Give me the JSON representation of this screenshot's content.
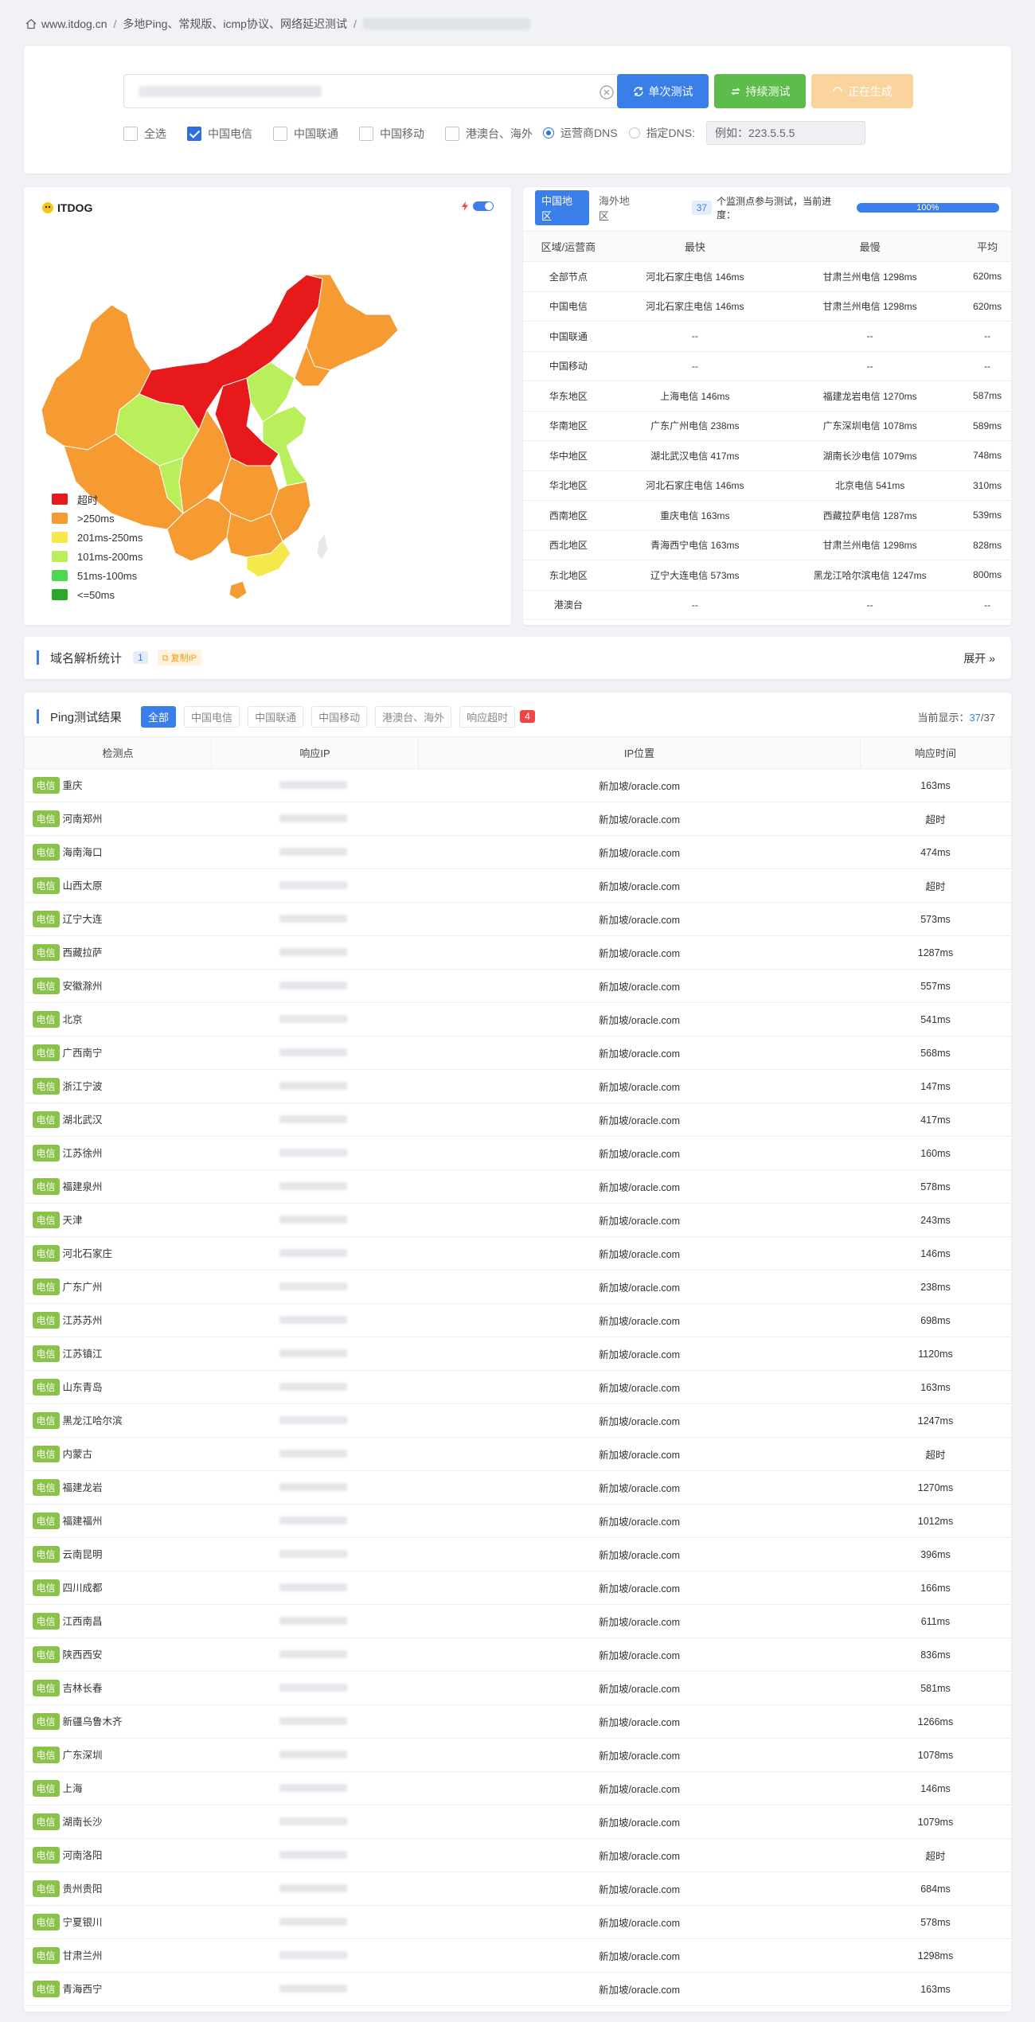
{
  "breadcrumb": {
    "home": "www.itdog.cn",
    "section": "多地Ping、常规版、icmp协议、网络延迟测试"
  },
  "search": {
    "btn_single": "单次测试",
    "btn_continuous": "持续测试",
    "btn_generating": "正在生成",
    "checks": [
      {
        "label": "全选",
        "checked": false
      },
      {
        "label": "中国电信",
        "checked": true
      },
      {
        "label": "中国联通",
        "checked": false
      },
      {
        "label": "中国移动",
        "checked": false
      },
      {
        "label": "港澳台、海外",
        "checked": false
      }
    ],
    "radio_isp": "运营商DNS",
    "radio_custom": "指定DNS:",
    "dns_placeholder": "例如：223.5.5.5"
  },
  "map": {
    "logo": "ITDOG",
    "legend": [
      {
        "label": "超时",
        "color": "#e8191b"
      },
      {
        "label": ">250ms",
        "color": "#f59b32"
      },
      {
        "label": "201ms-250ms",
        "color": "#f5e84a"
      },
      {
        "label": "101ms-200ms",
        "color": "#b9ef5a"
      },
      {
        "label": "51ms-100ms",
        "color": "#4cd94f"
      },
      {
        "label": "<=50ms",
        "color": "#2aa82a"
      }
    ]
  },
  "stats": {
    "tab_cn": "中国地区",
    "tab_abroad": "海外地区",
    "count": "37",
    "progress_text": "个监测点参与测试，当前进度：",
    "progress": "100%",
    "headers": [
      "区域/运营商",
      "最快",
      "最慢",
      "平均"
    ],
    "rows": [
      [
        "全部节点",
        "河北石家庄电信 146ms",
        "甘肃兰州电信 1298ms",
        "620ms"
      ],
      [
        "中国电信",
        "河北石家庄电信 146ms",
        "甘肃兰州电信 1298ms",
        "620ms"
      ],
      [
        "中国联通",
        "--",
        "--",
        "--"
      ],
      [
        "中国移动",
        "--",
        "--",
        "--"
      ],
      [
        "华东地区",
        "上海电信 146ms",
        "福建龙岩电信 1270ms",
        "587ms"
      ],
      [
        "华南地区",
        "广东广州电信 238ms",
        "广东深圳电信 1078ms",
        "589ms"
      ],
      [
        "华中地区",
        "湖北武汉电信 417ms",
        "湖南长沙电信 1079ms",
        "748ms"
      ],
      [
        "华北地区",
        "河北石家庄电信 146ms",
        "北京电信 541ms",
        "310ms"
      ],
      [
        "西南地区",
        "重庆电信 163ms",
        "西藏拉萨电信 1287ms",
        "539ms"
      ],
      [
        "西北地区",
        "青海西宁电信 163ms",
        "甘肃兰州电信 1298ms",
        "828ms"
      ],
      [
        "东北地区",
        "辽宁大连电信 573ms",
        "黑龙江哈尔滨电信 1247ms",
        "800ms"
      ],
      [
        "港澳台",
        "--",
        "--",
        "--"
      ]
    ]
  },
  "domain": {
    "title": "域名解析统计",
    "count": "1",
    "copy": "复制IP",
    "expand": "展开"
  },
  "ping": {
    "title": "Ping测试结果",
    "filters": [
      "全部",
      "中国电信",
      "中国联通",
      "中国移动",
      "港澳台、海外",
      "响应超时"
    ],
    "timeout_count": "4",
    "shown_label": "当前显示：",
    "shown_num": "37",
    "shown_total": "/37",
    "headers": [
      "检测点",
      "响应IP",
      "IP位置",
      "响应时间"
    ],
    "isp": "电信",
    "rows": [
      [
        "重庆",
        "新加坡/oracle.com",
        "163ms"
      ],
      [
        "河南郑州",
        "新加坡/oracle.com",
        "超时"
      ],
      [
        "海南海口",
        "新加坡/oracle.com",
        "474ms"
      ],
      [
        "山西太原",
        "新加坡/oracle.com",
        "超时"
      ],
      [
        "辽宁大连",
        "新加坡/oracle.com",
        "573ms"
      ],
      [
        "西藏拉萨",
        "新加坡/oracle.com",
        "1287ms"
      ],
      [
        "安徽滁州",
        "新加坡/oracle.com",
        "557ms"
      ],
      [
        "北京",
        "新加坡/oracle.com",
        "541ms"
      ],
      [
        "广西南宁",
        "新加坡/oracle.com",
        "568ms"
      ],
      [
        "浙江宁波",
        "新加坡/oracle.com",
        "147ms"
      ],
      [
        "湖北武汉",
        "新加坡/oracle.com",
        "417ms"
      ],
      [
        "江苏徐州",
        "新加坡/oracle.com",
        "160ms"
      ],
      [
        "福建泉州",
        "新加坡/oracle.com",
        "578ms"
      ],
      [
        "天津",
        "新加坡/oracle.com",
        "243ms"
      ],
      [
        "河北石家庄",
        "新加坡/oracle.com",
        "146ms"
      ],
      [
        "广东广州",
        "新加坡/oracle.com",
        "238ms"
      ],
      [
        "江苏苏州",
        "新加坡/oracle.com",
        "698ms"
      ],
      [
        "江苏镇江",
        "新加坡/oracle.com",
        "1120ms"
      ],
      [
        "山东青岛",
        "新加坡/oracle.com",
        "163ms"
      ],
      [
        "黑龙江哈尔滨",
        "新加坡/oracle.com",
        "1247ms"
      ],
      [
        "内蒙古",
        "新加坡/oracle.com",
        "超时"
      ],
      [
        "福建龙岩",
        "新加坡/oracle.com",
        "1270ms"
      ],
      [
        "福建福州",
        "新加坡/oracle.com",
        "1012ms"
      ],
      [
        "云南昆明",
        "新加坡/oracle.com",
        "396ms"
      ],
      [
        "四川成都",
        "新加坡/oracle.com",
        "166ms"
      ],
      [
        "江西南昌",
        "新加坡/oracle.com",
        "611ms"
      ],
      [
        "陕西西安",
        "新加坡/oracle.com",
        "836ms"
      ],
      [
        "吉林长春",
        "新加坡/oracle.com",
        "581ms"
      ],
      [
        "新疆乌鲁木齐",
        "新加坡/oracle.com",
        "1266ms"
      ],
      [
        "广东深圳",
        "新加坡/oracle.com",
        "1078ms"
      ],
      [
        "上海",
        "新加坡/oracle.com",
        "146ms"
      ],
      [
        "湖南长沙",
        "新加坡/oracle.com",
        "1079ms"
      ],
      [
        "河南洛阳",
        "新加坡/oracle.com",
        "超时"
      ],
      [
        "贵州贵阳",
        "新加坡/oracle.com",
        "684ms"
      ],
      [
        "宁夏银川",
        "新加坡/oracle.com",
        "578ms"
      ],
      [
        "甘肃兰州",
        "新加坡/oracle.com",
        "1298ms"
      ],
      [
        "青海西宁",
        "新加坡/oracle.com",
        "163ms"
      ]
    ]
  }
}
